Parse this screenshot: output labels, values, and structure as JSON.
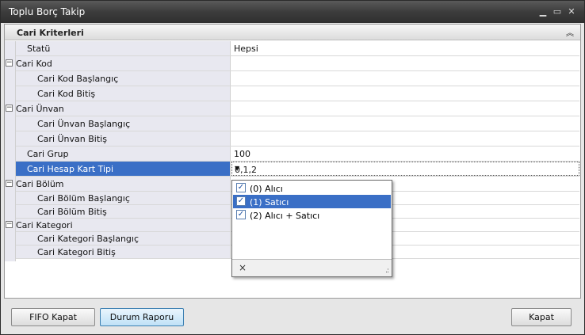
{
  "window": {
    "title": "Toplu Borç Takip"
  },
  "category": {
    "label": "Cari Kriterleri"
  },
  "rows": [
    {
      "name": "Statü",
      "value": "Hepsi"
    },
    {
      "name": "Cari Kod",
      "value": ""
    },
    {
      "name": "Cari Kod Başlangıç",
      "value": ""
    },
    {
      "name": "Cari Kod Bitiş",
      "value": ""
    },
    {
      "name": "Cari Ünvan",
      "value": ""
    },
    {
      "name": "Cari Ünvan Başlangıç",
      "value": ""
    },
    {
      "name": "Cari Ünvan Bitiş",
      "value": ""
    },
    {
      "name": "Cari Grup",
      "value": "100"
    },
    {
      "name": "Cari Hesap Kart Tipi",
      "value": "0,1,2"
    },
    {
      "name": "Cari Bölüm",
      "value": ""
    },
    {
      "name": "Cari Bölüm Başlangıç",
      "value": ""
    },
    {
      "name": "Cari Bölüm Bitiş",
      "value": ""
    },
    {
      "name": "Cari Kategori",
      "value": ""
    },
    {
      "name": "Cari Kategori Başlangıç",
      "value": ""
    },
    {
      "name": "Cari Kategori Bitiş",
      "value": ""
    }
  ],
  "popup": {
    "items": [
      {
        "label": "(0) Alıcı",
        "checked": true
      },
      {
        "label": "(1) Satıcı",
        "checked": true
      },
      {
        "label": "(2) Alıcı + Satıcı",
        "checked": true
      }
    ],
    "close_symbol": "×"
  },
  "buttons": {
    "fifo": "FIFO Kapat",
    "durum": "Durum Raporu",
    "kapat": "Kapat"
  },
  "colors": {
    "selection": "#3a6fc6",
    "titlebar": "#3c3c3c"
  }
}
